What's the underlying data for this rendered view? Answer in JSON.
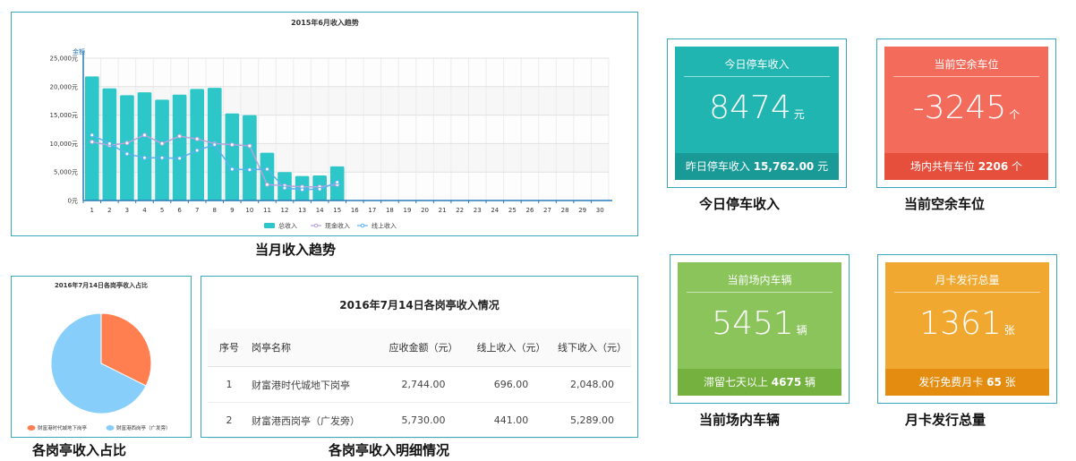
{
  "trend": {
    "caption": "当月收入趋势",
    "chart_data": {
      "type": "bar",
      "title": "2015年6月收入趋势",
      "ylabel": "金额",
      "ylim": [
        0,
        25000
      ],
      "yticks": [
        "0元",
        "5,000元",
        "10,000元",
        "15,000元",
        "20,000元",
        "25,000元"
      ],
      "categories": [
        "1",
        "2",
        "3",
        "4",
        "5",
        "6",
        "7",
        "8",
        "9",
        "10",
        "11",
        "12",
        "13",
        "14",
        "15",
        "16",
        "17",
        "18",
        "19",
        "20",
        "21",
        "22",
        "23",
        "24",
        "25",
        "26",
        "27",
        "28",
        "29",
        "30"
      ],
      "series": [
        {
          "name": "总收入",
          "type": "bar",
          "color": "#2ec7c9",
          "values": [
            21800,
            19700,
            18500,
            19000,
            17700,
            18600,
            19600,
            19800,
            15300,
            15000,
            8400,
            5000,
            4300,
            4400,
            6000
          ]
        },
        {
          "name": "现金收入",
          "type": "line",
          "color": "#b6a2de",
          "values": [
            10300,
            9700,
            10100,
            11500,
            10000,
            11300,
            10800,
            10000,
            9800,
            9600,
            2800,
            2600,
            2400,
            2400,
            2800
          ]
        },
        {
          "name": "线上收入",
          "type": "line",
          "color": "#5ab1ef",
          "values": [
            11500,
            10000,
            8200,
            7500,
            7500,
            7400,
            8800,
            9800,
            5500,
            5400,
            5500,
            2200,
            1900,
            2000,
            3200
          ]
        }
      ],
      "grid": true,
      "legend": "bottom"
    }
  },
  "pie": {
    "caption": "各岗亭收入占比",
    "chart_data": {
      "type": "pie",
      "title": "2016年7月14日各岗亭收入占比",
      "labels": [
        "财富港时代城地下岗亭",
        "财富港西岗亭（广发旁）"
      ],
      "values": [
        2744.0,
        5730.0
      ],
      "colors": [
        "#ff7f50",
        "#87cefa"
      ],
      "legend": "bottom"
    }
  },
  "table": {
    "caption": "各岗亭收入明细情况",
    "title": "2016年7月14日各岗亭收入情况",
    "headers": [
      "序号",
      "岗亭名称",
      "应收金额（元）",
      "线上收入（元）",
      "线下收入（元）"
    ],
    "rows": [
      [
        "1",
        "财富港时代城地下岗亭",
        "2,744.00",
        "696.00",
        "2,048.00"
      ],
      [
        "2",
        "财富港西岗亭（广发旁）",
        "5,730.00",
        "441.00",
        "5,289.00"
      ]
    ]
  },
  "kpis": [
    {
      "caption": "今日停车收入",
      "title": "今日停车收入",
      "value": "8474",
      "unit": "元",
      "foot_prefix": "昨日停车收入",
      "foot_value": "15,762.00",
      "foot_unit": "元",
      "color": "#20b5b0",
      "foot_color": "#1a9a96"
    },
    {
      "caption": "当前空余车位",
      "title": "当前空余车位",
      "value": "-3245",
      "unit": "个",
      "foot_prefix": "场内共有车位",
      "foot_value": "2206",
      "foot_unit": "个",
      "color": "#f26b5b",
      "foot_color": "#e64f3c"
    },
    {
      "caption": "当前场内车辆",
      "title": "当前场内车辆",
      "value": "5451",
      "unit": "辆",
      "foot_prefix": "滞留七天以上",
      "foot_value": "4675",
      "foot_unit": "辆",
      "color": "#8bc45b",
      "foot_color": "#74b13e"
    },
    {
      "caption": "月卡发行总量",
      "title": "月卡发行总量",
      "value": "1361",
      "unit": "张",
      "foot_prefix": "发行免费月卡",
      "foot_value": "65",
      "foot_unit": "张",
      "color": "#f0a830",
      "foot_color": "#e38c10"
    }
  ]
}
